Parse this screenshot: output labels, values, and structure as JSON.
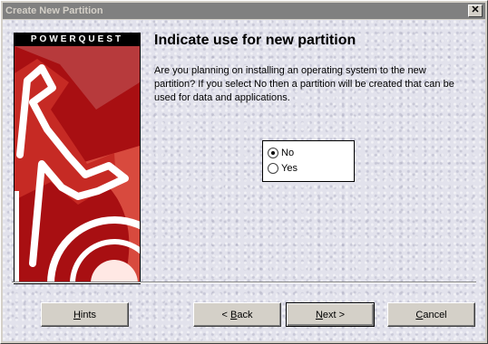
{
  "window": {
    "title": "Create New Partition",
    "close_glyph": "✕"
  },
  "logo": {
    "brand": "POWERQUEST"
  },
  "page": {
    "heading": "Indicate use for new partition",
    "description": "Are you planning on installing an operating system to the new partition?   If you select No then a partition will be created that can be used for data and applications."
  },
  "options": {
    "selected": "No",
    "items": [
      {
        "label": "No",
        "checked": true
      },
      {
        "label": "Yes",
        "checked": false
      }
    ]
  },
  "buttons": {
    "hints": {
      "accel": "H",
      "rest": "ints"
    },
    "back": {
      "pre": "< ",
      "accel": "B",
      "rest": "ack"
    },
    "next": {
      "accel": "N",
      "rest": "ext >"
    },
    "cancel": {
      "accel": "C",
      "rest": "ancel"
    }
  },
  "colors": {
    "titlebar": "#808080",
    "brand_red": "#b21414",
    "face": "#d4d0c8"
  }
}
